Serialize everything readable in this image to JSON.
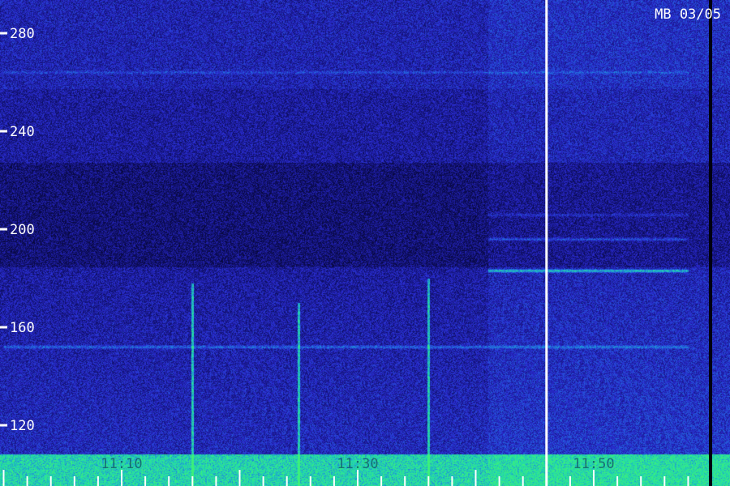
{
  "chart_data": {
    "type": "heatmap",
    "title": "MB 03/05",
    "xlabel": "",
    "ylabel": "",
    "ylim": [
      110,
      290
    ],
    "yticks": [
      120,
      160,
      200,
      240,
      280
    ],
    "ytick_labels": [
      "120",
      "160",
      "200",
      "240",
      "280"
    ],
    "xlim": [
      "11:00",
      "11:58"
    ],
    "xticks": [
      "11:10",
      "11:30",
      "11:50"
    ],
    "x_minor_tick_step_minutes": 2,
    "colormap": [
      "#000010",
      "#10106a",
      "#2a2ad0",
      "#1f7fe0",
      "#20d8b0",
      "#3cf07a"
    ],
    "grid": false,
    "legend": "none",
    "events": [
      {
        "time": "11:16",
        "type": "broadband-burst",
        "y_range": [
          112,
          178
        ]
      },
      {
        "time": "11:25",
        "type": "broadband-burst",
        "y_range": [
          112,
          170
        ]
      },
      {
        "time": "11:36",
        "type": "broadband-burst",
        "y_range": [
          112,
          180
        ]
      },
      {
        "time": "11:46",
        "type": "data-gap-marker",
        "y_range": [
          110,
          290
        ]
      }
    ],
    "persistent_bands": [
      {
        "y": 152,
        "strength": "medium",
        "from": "11:00",
        "to": "11:58"
      },
      {
        "y": 183,
        "strength": "strong",
        "from": "11:41",
        "to": "11:58"
      },
      {
        "y": 196,
        "strength": "medium",
        "from": "11:41",
        "to": "11:58"
      },
      {
        "y": 206,
        "strength": "weak",
        "from": "11:41",
        "to": "11:58"
      },
      {
        "y": 264,
        "strength": "weak",
        "from": "11:00",
        "to": "11:58"
      }
    ]
  }
}
